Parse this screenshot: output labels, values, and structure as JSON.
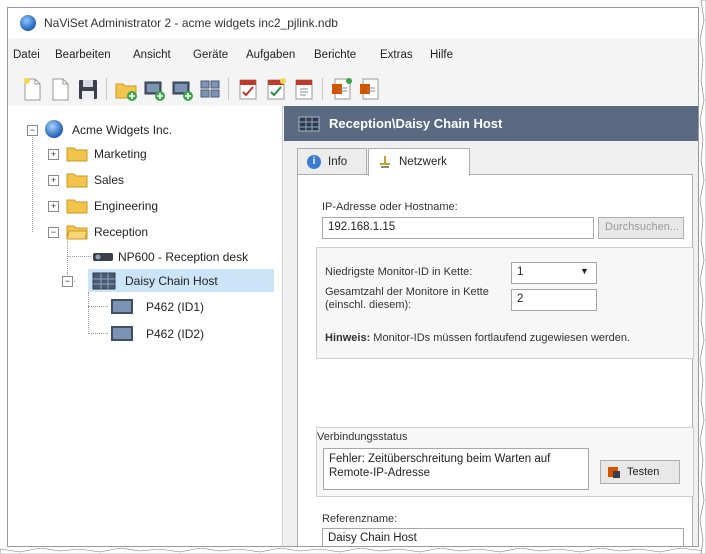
{
  "window": {
    "title": "NaViSet Administrator 2 - acme widgets inc2_pjlink.ndb"
  },
  "menubar": {
    "items": [
      "Datei",
      "Bearbeiten",
      "Ansicht",
      "Geräte",
      "Aufgaben",
      "Berichte",
      "Extras",
      "Hilfe"
    ]
  },
  "toolbar": {
    "buttons": [
      "new-icon",
      "open-icon",
      "save-icon",
      "new-group-icon",
      "add-device-icon",
      "add-device-icon",
      "device-grid-icon",
      "task-check-icon",
      "task-check-icon",
      "task-doc-icon",
      "report-icon",
      "report-icon"
    ]
  },
  "tree": {
    "root": "Acme Widgets Inc.",
    "folders": [
      {
        "label": "Marketing",
        "expanded": false
      },
      {
        "label": "Sales",
        "expanded": false
      },
      {
        "label": "Engineering",
        "expanded": false
      },
      {
        "label": "Reception",
        "expanded": true
      }
    ],
    "reception_children": [
      {
        "label": "NP600 - Reception desk",
        "icon": "projector-icon"
      },
      {
        "label": "Daisy Chain Host",
        "icon": "monitor-icon",
        "selected": true
      }
    ],
    "chain_children": [
      {
        "label": "P462 (ID1)"
      },
      {
        "label": "P462 (ID2)"
      }
    ]
  },
  "detail": {
    "header_title": "Reception\\Daisy Chain Host",
    "tabs": [
      {
        "label": "Info",
        "active": false
      },
      {
        "label": "Netzwerk",
        "active": true
      }
    ],
    "ip_label": "IP-Adresse oder Hostname:",
    "ip_value": "192.168.1.15",
    "browse_button": "Durchsuchen...",
    "lowest_id_label": "Niedrigste Monitor-ID in Kette:",
    "lowest_id_value": "1",
    "total_label_line1": "Gesamtzahl der Monitore in Kette",
    "total_label_line2": "(einschl. diesem):",
    "total_value": "2",
    "hint_bold": "Hinweis:",
    "hint_text": "Monitor-IDs müssen fortlaufend zugewiesen werden.",
    "status_label": "Verbindungsstatus",
    "status_line1": "Fehler: Zeitüberschreitung beim Warten auf",
    "status_line2": "Remote-IP-Adresse",
    "test_button": "Testen",
    "refname_label": "Referenzname:",
    "refname_value": "Daisy Chain Host"
  },
  "colors": {
    "header_bg": "#5a6a82",
    "selection_bg": "#cce4f7",
    "folder": "#f2c44c"
  }
}
